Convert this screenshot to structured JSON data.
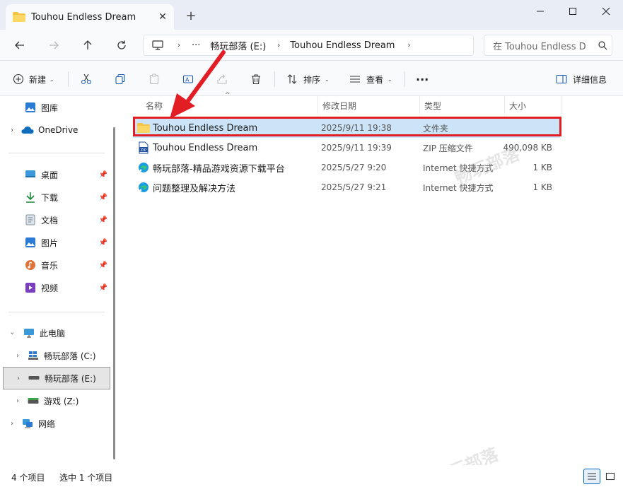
{
  "window": {
    "tab_title": "Touhou Endless Dream",
    "new_tab": "+",
    "tab_close": "✕"
  },
  "nav": {
    "breadcrumb": [
      "畅玩部落 (E:)",
      "Touhou Endless Dream"
    ],
    "more": "···",
    "search_placeholder": "在 Touhou Endless D"
  },
  "toolbar": {
    "new_label": "新建",
    "sort_label": "排序",
    "view_label": "查看",
    "more": "···",
    "details_label": "详细信息"
  },
  "sidebar": {
    "gallery": "图库",
    "onedrive": "OneDrive",
    "quick_access": [
      "桌面",
      "下载",
      "文档",
      "图片",
      "音乐",
      "视频"
    ],
    "this_pc": "此电脑",
    "drives": [
      "畅玩部落 (C:)",
      "畅玩部落 (E:)",
      "游戏 (Z:)"
    ],
    "network": "网络"
  },
  "columns": {
    "name": "名称",
    "date": "修改日期",
    "type": "类型",
    "size": "大小"
  },
  "files": [
    {
      "name": "Touhou Endless Dream",
      "date": "2025/9/11 19:38",
      "type": "文件夹",
      "size": "",
      "icon": "folder-icon",
      "selected": true
    },
    {
      "name": "Touhou Endless Dream",
      "date": "2025/9/11 19:39",
      "type": "ZIP 压缩文件",
      "size": "490,098 KB",
      "icon": "zip-icon"
    },
    {
      "name": "畅玩部落-精品游戏资源下载平台",
      "date": "2025/5/27 9:20",
      "type": "Internet 快捷方式",
      "size": "1 KB",
      "icon": "edge-icon"
    },
    {
      "name": "问题整理及解决方法",
      "date": "2025/5/27 9:21",
      "type": "Internet 快捷方式",
      "size": "1 KB",
      "icon": "edge-icon"
    }
  ],
  "status": {
    "item_count": "4 个项目",
    "selected": "选中 1 个项目"
  },
  "watermark": "畅玩部落",
  "colors": {
    "accent": "#0067c0",
    "selection": "#cce4f7",
    "highlight_box": "#e21d24",
    "folder": "#f6c445"
  }
}
